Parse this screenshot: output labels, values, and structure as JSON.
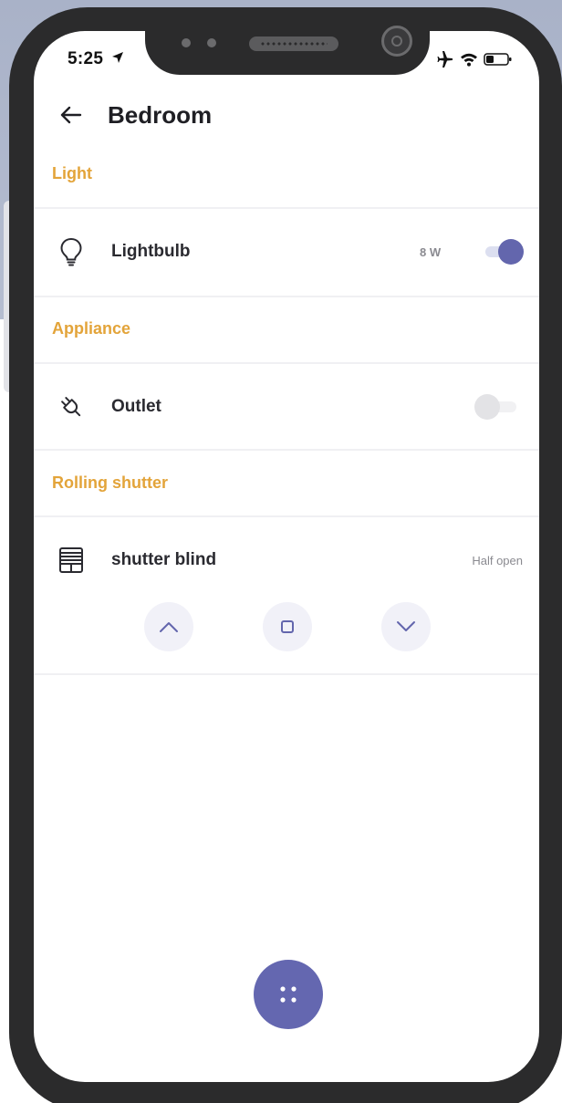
{
  "status_bar": {
    "time": "5:25",
    "icons": [
      "location-arrow-icon",
      "airplane-icon",
      "wifi-icon",
      "battery-icon"
    ]
  },
  "header": {
    "back_icon": "back-arrow-icon",
    "title": "Bedroom"
  },
  "sections": [
    {
      "label": "Light",
      "device": {
        "name": "Lightbulb",
        "icon": "lightbulb-icon",
        "power": "8 W",
        "toggle_on": true
      }
    },
    {
      "label": "Appliance",
      "device": {
        "name": "Outlet",
        "icon": "plug-icon",
        "toggle_on": false
      }
    },
    {
      "label": "Rolling shutter",
      "device": {
        "name": "shutter blind",
        "icon": "shutter-blind-icon",
        "state": "Half open",
        "controls": [
          "chevron-up-icon",
          "stop-square-icon",
          "chevron-down-icon"
        ]
      }
    }
  ],
  "fab": {
    "icon": "grid-dots-icon"
  },
  "colors": {
    "accent": "#6366ad",
    "section_label": "#e3a43a",
    "toggle_off": "#e3e3e6",
    "control_bg": "#f1f1f8"
  }
}
